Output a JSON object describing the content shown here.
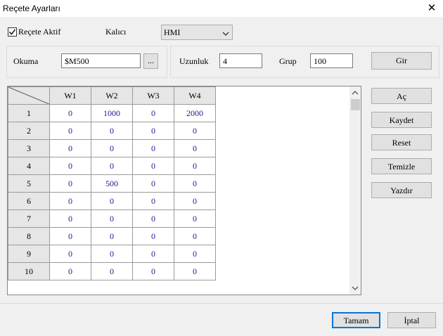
{
  "window": {
    "title": "Reçete Ayarları"
  },
  "top": {
    "recipe_active_label": "Reçete Aktif",
    "recipe_active_checked": true,
    "kalici_label": "Kalıcı",
    "kalici_value": "HMI"
  },
  "read": {
    "label": "Okuma",
    "address": "$M500",
    "browse_label": "..."
  },
  "settings": {
    "length_label": "Uzunluk",
    "length_value": "4",
    "group_label": "Grup",
    "group_value": "100",
    "enter_label": "Gir"
  },
  "table": {
    "columns": [
      "W1",
      "W2",
      "W3",
      "W4"
    ],
    "rows": [
      {
        "label": "1",
        "values": [
          "0",
          "1000",
          "0",
          "2000"
        ]
      },
      {
        "label": "2",
        "values": [
          "0",
          "0",
          "0",
          "0"
        ]
      },
      {
        "label": "3",
        "values": [
          "0",
          "0",
          "0",
          "0"
        ]
      },
      {
        "label": "4",
        "values": [
          "0",
          "0",
          "0",
          "0"
        ]
      },
      {
        "label": "5",
        "values": [
          "0",
          "500",
          "0",
          "0"
        ]
      },
      {
        "label": "6",
        "values": [
          "0",
          "0",
          "0",
          "0"
        ]
      },
      {
        "label": "7",
        "values": [
          "0",
          "0",
          "0",
          "0"
        ]
      },
      {
        "label": "8",
        "values": [
          "0",
          "0",
          "0",
          "0"
        ]
      },
      {
        "label": "9",
        "values": [
          "0",
          "0",
          "0",
          "0"
        ]
      },
      {
        "label": "10",
        "values": [
          "0",
          "0",
          "0",
          "0"
        ]
      }
    ]
  },
  "side_buttons": {
    "open": "Aç",
    "save": "Kaydet",
    "reset": "Reset",
    "clear": "Temizle",
    "print": "Yazdır"
  },
  "footer": {
    "ok": "Tamam",
    "cancel": "İptal"
  }
}
